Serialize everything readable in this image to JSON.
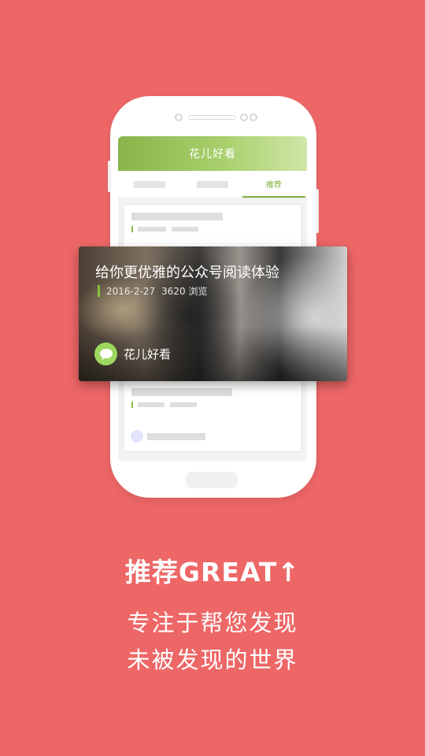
{
  "colors": {
    "background": "#ee6767",
    "accent_green": "#7fb03f",
    "header_gradient_start": "#89b54c",
    "header_gradient_end": "#cfe7a7"
  },
  "app": {
    "header_title": "花儿好看",
    "tabs": [
      {
        "label": "",
        "active": false
      },
      {
        "label": "",
        "active": false
      },
      {
        "label": "推荐",
        "active": true
      }
    ]
  },
  "feature_card": {
    "title": "给你更优雅的公众号阅读体验",
    "date": "2016-2-27",
    "views": "3620 浏览",
    "author": "花儿好看",
    "author_icon": "chat-bubble-icon"
  },
  "promo": {
    "headline": "推荐GREAT↑",
    "line1": "专注于帮您发现",
    "line2": "未被发现的世界"
  }
}
